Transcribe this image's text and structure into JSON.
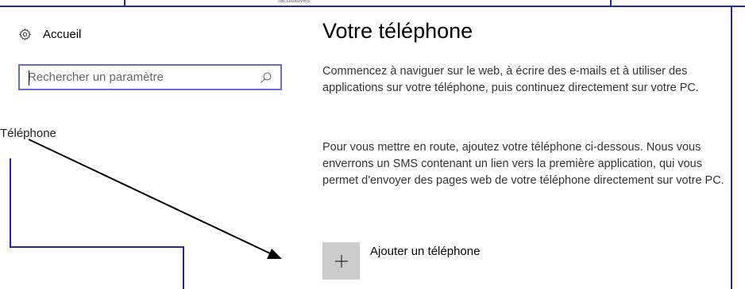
{
  "header": {
    "caption": "facultatives"
  },
  "sidebar": {
    "home_label": "Accueil",
    "search": {
      "placeholder": "Rechercher un paramètre",
      "value": ""
    },
    "items": [
      {
        "label": "Téléphone"
      }
    ]
  },
  "main": {
    "title": "Votre téléphone",
    "paragraph1": "Commencez à naviguer sur le web, à écrire des e-mails et à utiliser des applications sur votre téléphone, puis continuez directement sur votre PC.",
    "paragraph2": "Pour vous mettre en route, ajoutez votre téléphone ci-dessous. Nous vous enverrons un SMS contenant un lien vers la première application, qui vous permet d'envoyer des pages web de votre téléphone directement sur votre PC.",
    "add_phone_label": "Ajouter un téléphone"
  },
  "colors": {
    "frame_line": "#1f2b9e",
    "search_border": "#6b6bd0",
    "add_button_bg": "#cccccc"
  }
}
